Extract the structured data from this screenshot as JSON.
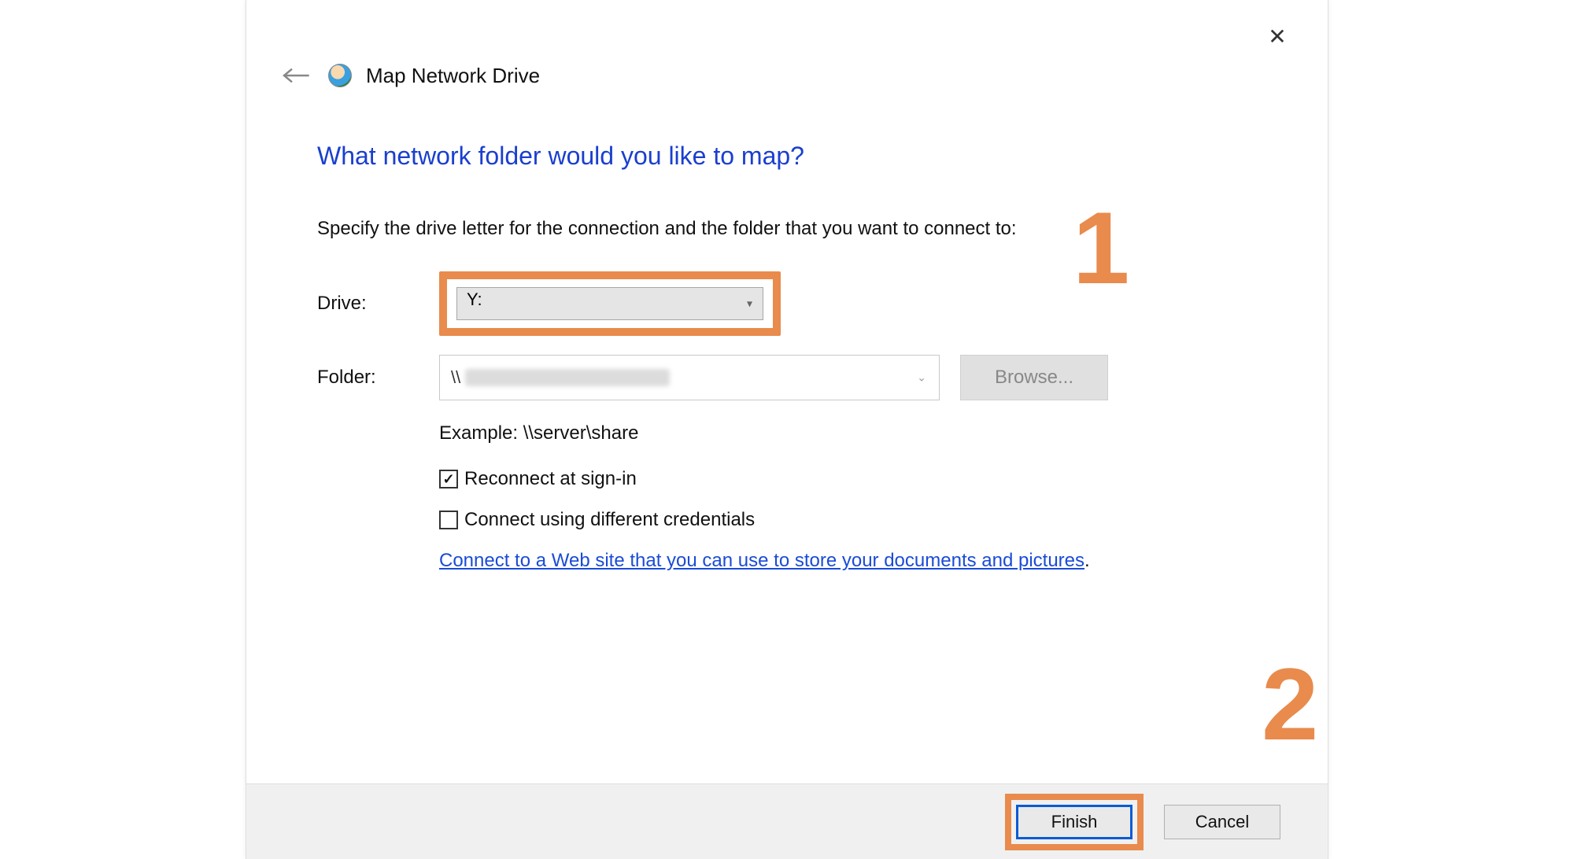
{
  "dialog": {
    "title": "Map Network Drive",
    "close_label": "✕",
    "heading": "What network folder would you like to map?",
    "instruction": "Specify the drive letter for the connection and the folder that you want to connect to:",
    "drive_label": "Drive:",
    "drive_value": "Y:",
    "folder_label": "Folder:",
    "folder_prefix": "\\\\",
    "browse_label": "Browse...",
    "example_text": "Example: \\\\server\\share",
    "reconnect_label": "Reconnect at sign-in",
    "reconnect_checked": true,
    "diffcreds_label": "Connect using different credentials",
    "diffcreds_checked": false,
    "link_text": "Connect to a Web site that you can use to store your documents and pictures",
    "link_period": ".",
    "finish_label": "Finish",
    "cancel_label": "Cancel"
  },
  "annotations": {
    "callout1": "1",
    "callout2": "2"
  },
  "colors": {
    "accent_highlight": "#e88b4d",
    "heading_blue": "#1a3fcf",
    "link_blue": "#1a4bd6",
    "finish_border_blue": "#0a5bd3"
  }
}
